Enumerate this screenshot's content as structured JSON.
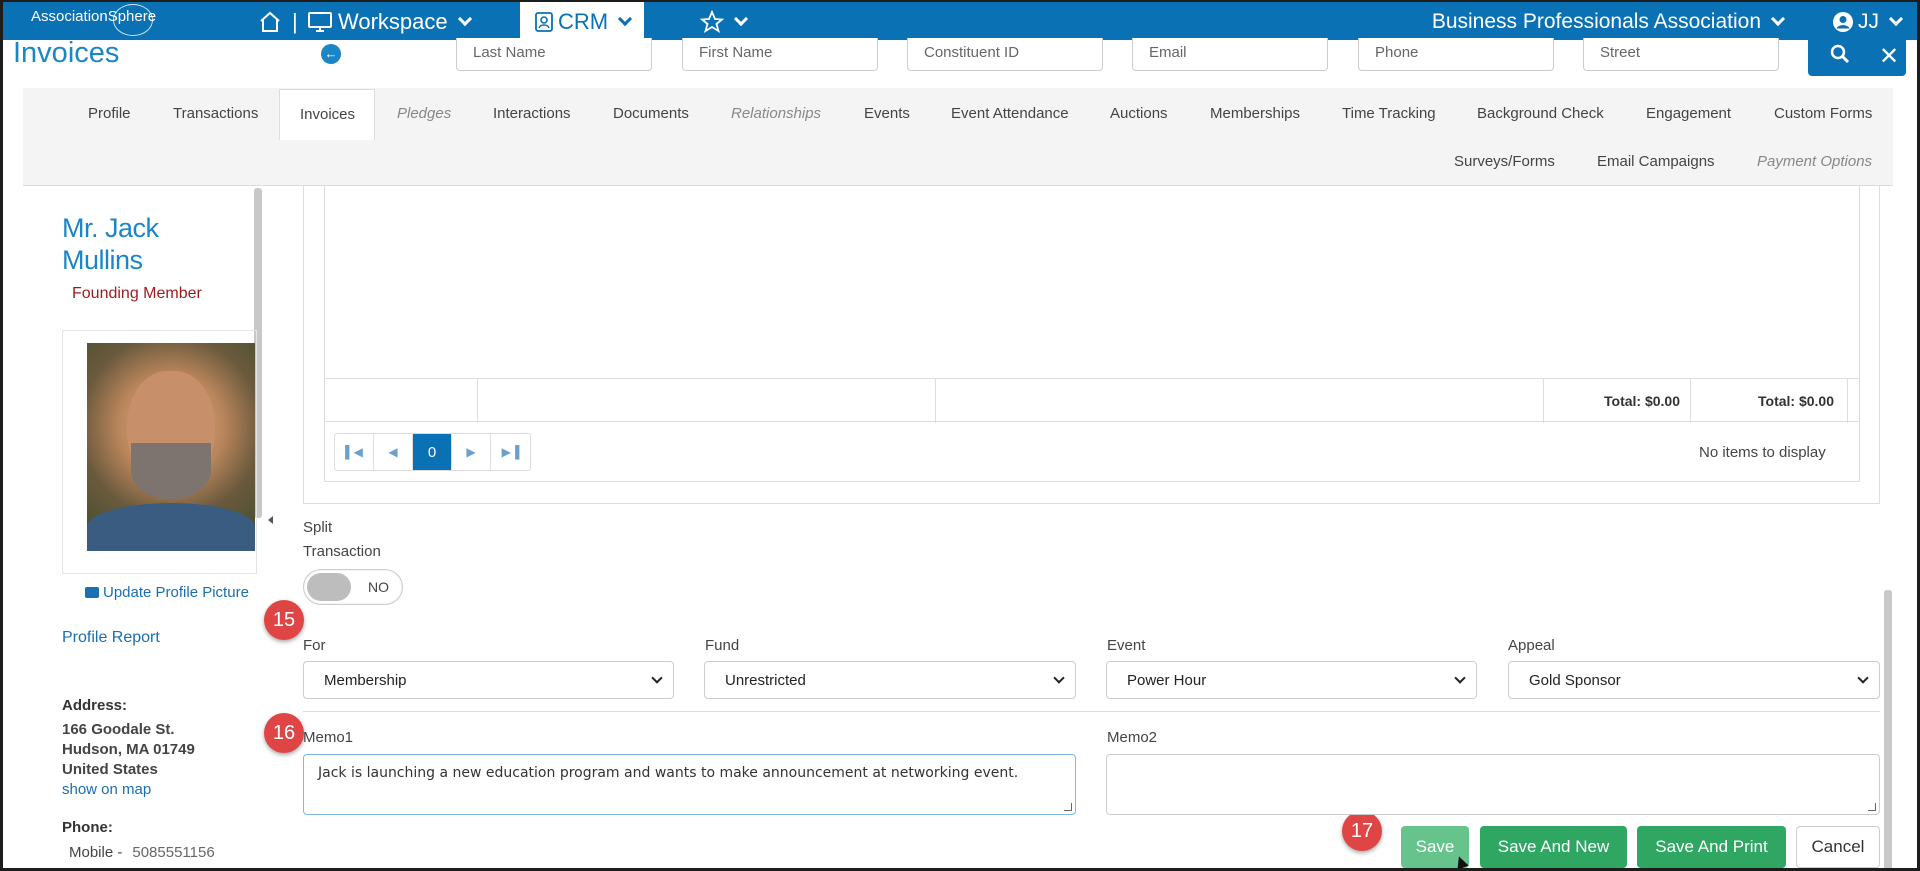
{
  "topbar": {
    "logo": "AssociationSphere",
    "workspace": "Workspace",
    "crm": "CRM",
    "org": "Business Professionals Association",
    "user": "JJ",
    "separator": "|"
  },
  "page": {
    "title": "Invoices"
  },
  "search": {
    "last_name": "Last Name",
    "first_name": "First Name",
    "constituent_id": "Constituent ID",
    "email": "Email",
    "phone": "Phone",
    "street": "Street"
  },
  "tabs": {
    "profile": "Profile",
    "transactions": "Transactions",
    "invoices": "Invoices",
    "pledges": "Pledges",
    "interactions": "Interactions",
    "documents": "Documents",
    "relationships": "Relationships",
    "events": "Events",
    "event_attendance": "Event Attendance",
    "auctions": "Auctions",
    "memberships": "Memberships",
    "time_tracking": "Time Tracking",
    "background_check": "Background Check",
    "engagement": "Engagement",
    "custom_forms": "Custom Forms",
    "surveys_forms": "Surveys/Forms",
    "email_campaigns": "Email Campaigns",
    "payment_options": "Payment Options"
  },
  "contact": {
    "name_line1": "Mr. Jack",
    "name_line2": "Mullins",
    "member_type": "Founding Member",
    "update_picture": "Update Profile Picture",
    "profile_report": "Profile Report",
    "address_label": "Address:",
    "address_line1": "166 Goodale St.",
    "address_line2": "Hudson, MA 01749",
    "address_line3": "United States",
    "show_on_map": "show on map",
    "phone_label": "Phone:",
    "mobile_label": "Mobile -",
    "mobile_number": "5085551156"
  },
  "grid": {
    "total1": "Total: $0.00",
    "total2": "Total: $0.00",
    "current_page": "0",
    "no_items": "No items to display"
  },
  "split": {
    "label_line1": "Split",
    "label_line2": "Transaction",
    "toggle_value": "NO"
  },
  "badges": {
    "b15": "15",
    "b16": "16",
    "b17": "17"
  },
  "form": {
    "for_label": "For",
    "for_value": "Membership",
    "fund_label": "Fund",
    "fund_value": "Unrestricted",
    "event_label": "Event",
    "event_value": "Power Hour",
    "appeal_label": "Appeal",
    "appeal_value": "Gold Sponsor",
    "memo1_label": "Memo1",
    "memo1_value": "Jack is launching a new education program and wants to make announcement at networking event.",
    "memo2_label": "Memo2",
    "memo2_value": ""
  },
  "buttons": {
    "save": "Save",
    "save_and_new": "Save And New",
    "save_and_print": "Save And Print",
    "cancel": "Cancel"
  },
  "colors": {
    "brand_blue": "#0a71b4",
    "link_blue": "#1a86c8",
    "member_red": "#9b1c1c",
    "badge_red": "#e04545",
    "button_green": "#2fa661"
  },
  "icons": [
    "home-icon",
    "monitor-icon",
    "contact-card-icon",
    "star-icon",
    "user-circle-icon",
    "search-icon",
    "close-icon",
    "back-arrow-icon",
    "camera-icon"
  ]
}
